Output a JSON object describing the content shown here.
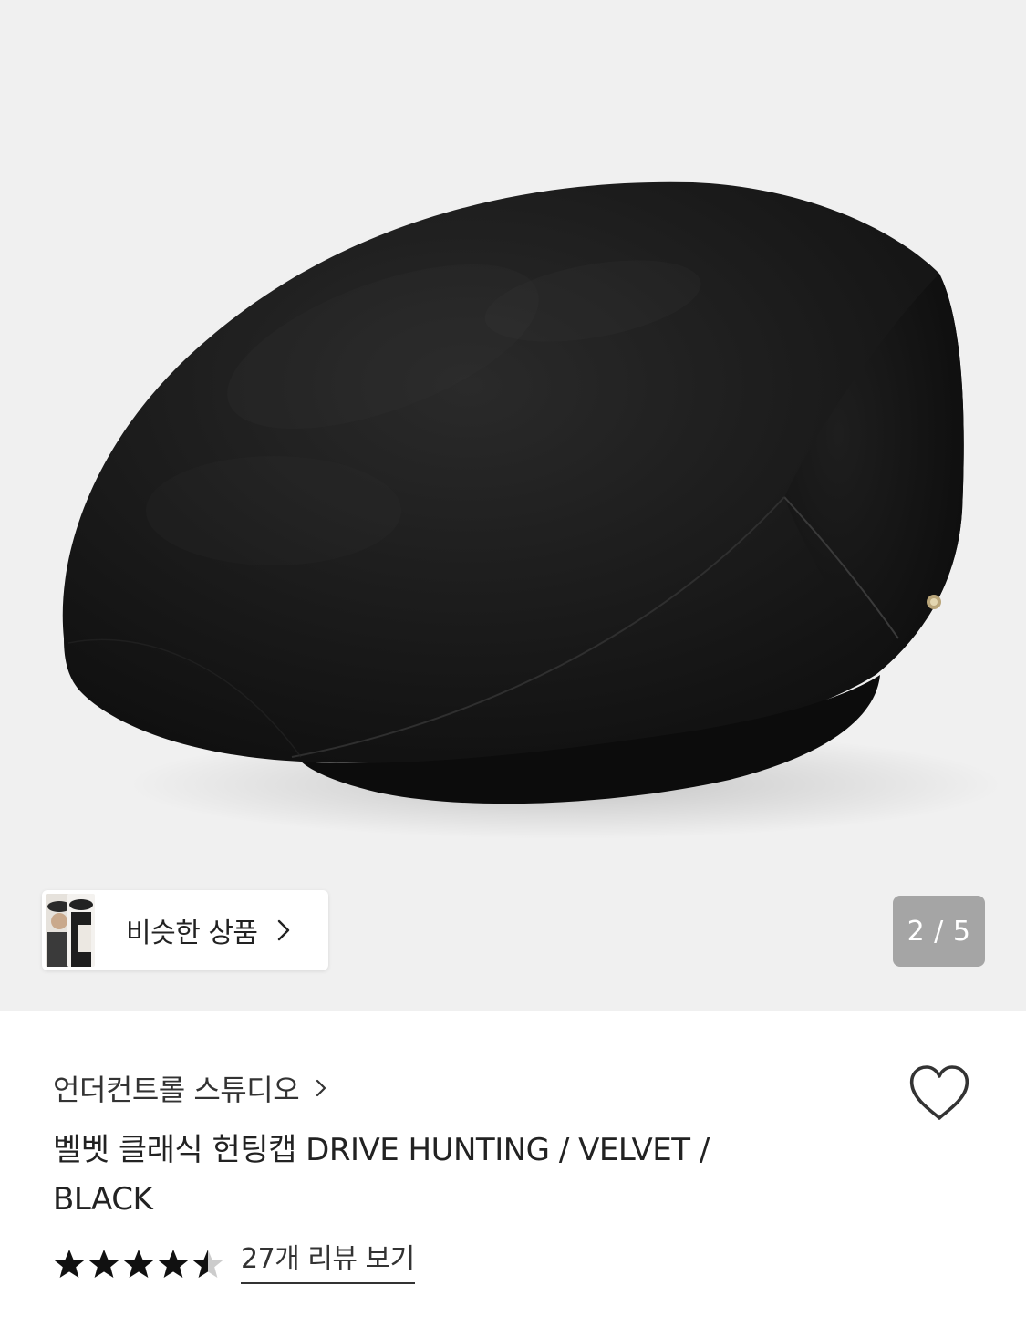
{
  "gallery": {
    "similar_button": {
      "label": "비슷한 상품",
      "thumbnail_icon": "similar-product-thumbnail"
    },
    "counter": {
      "current": 2,
      "total": 5,
      "text": "2 / 5"
    },
    "background_color": "#f0f0f0"
  },
  "product": {
    "brand": "언더컨트롤 스튜디오",
    "title": "벨벳 클래식 헌팅캡 DRIVE HUNTING / VELVET / BLACK",
    "rating": 4.5,
    "review_link": "27개 리뷰 보기",
    "like_icon": "heart-outline-icon"
  },
  "colors": {
    "text_primary": "#222222",
    "text_secondary": "#333333",
    "star": "#111111",
    "star_empty": "#cccccc",
    "counter_bg": "#8a8a8a"
  }
}
